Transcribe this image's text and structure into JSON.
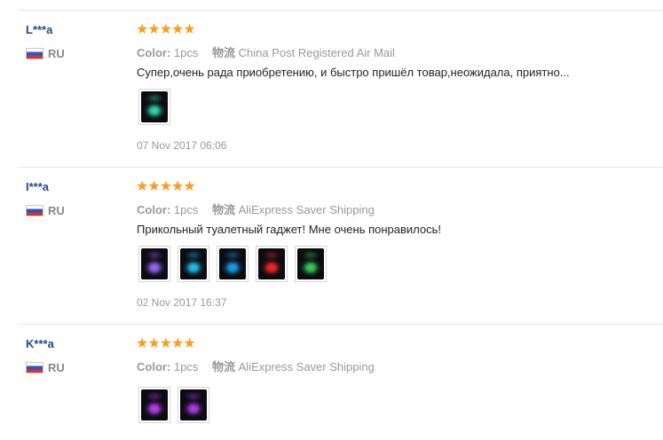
{
  "reviews": [
    {
      "user": "L***a",
      "country": "RU",
      "stars": "★★★★★",
      "color_label": "Color:",
      "color_value": "1pcs",
      "shipping_label": "物流",
      "shipping_value": "China Post Registered Air Mail",
      "comment": "Супер,очень рада приобретению, и быстро пришёл товар,неожидала, приятно...",
      "photos": [
        {
          "icon": "photo-teal-glow",
          "color": "#2ee0b0"
        }
      ],
      "date": "07 Nov 2017 06:06"
    },
    {
      "user": "I***a",
      "country": "RU",
      "stars": "★★★★★",
      "color_label": "Color:",
      "color_value": "1pcs",
      "shipping_label": "物流",
      "shipping_value": "AliExpress Saver Shipping",
      "comment": "Прикольный туалетный гаджет! Мне очень понравилось!",
      "photos": [
        {
          "icon": "photo-violet-glow",
          "color": "#9a6bff"
        },
        {
          "icon": "photo-cyan-glow",
          "color": "#1fc8ff"
        },
        {
          "icon": "photo-blue-glow",
          "color": "#1aa6ff"
        },
        {
          "icon": "photo-red-glow",
          "color": "#ff2a2a"
        },
        {
          "icon": "photo-green-glow",
          "color": "#3bd65a"
        }
      ],
      "date": "02 Nov 2017 16:37"
    },
    {
      "user": "K***a",
      "country": "RU",
      "stars": "★★★★★",
      "color_label": "Color:",
      "color_value": "1pcs",
      "shipping_label": "物流",
      "shipping_value": "AliExpress Saver Shipping",
      "comment": "",
      "photos": [
        {
          "icon": "photo-purple-glow",
          "color": "#c03cff"
        },
        {
          "icon": "photo-magenta-glow",
          "color": "#b23cf0"
        }
      ],
      "date": ""
    }
  ]
}
